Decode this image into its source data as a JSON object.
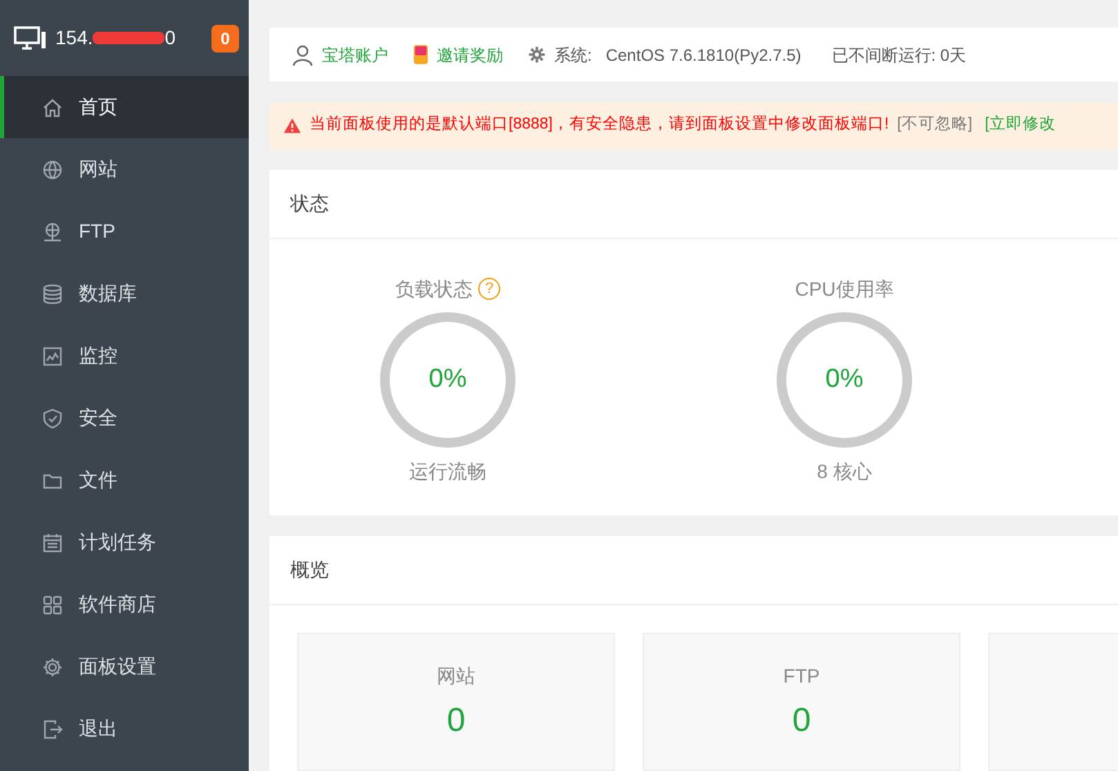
{
  "sidebar": {
    "host_start": "154.",
    "host_end": "0",
    "badge": "0",
    "items": [
      {
        "label": "首页",
        "selected": true
      },
      {
        "label": "网站",
        "selected": false
      },
      {
        "label": "FTP",
        "selected": false
      },
      {
        "label": "数据库",
        "selected": false
      },
      {
        "label": "监控",
        "selected": false
      },
      {
        "label": "安全",
        "selected": false
      },
      {
        "label": "文件",
        "selected": false
      },
      {
        "label": "计划任务",
        "selected": false
      },
      {
        "label": "软件商店",
        "selected": false
      },
      {
        "label": "面板设置",
        "selected": false
      },
      {
        "label": "退出",
        "selected": false
      }
    ]
  },
  "header": {
    "account": "宝塔账户",
    "invite": "邀请奖励",
    "system_label": "系统:",
    "system_value": "CentOS 7.6.1810(Py2.7.5)",
    "uptime": "已不间断运行: 0天"
  },
  "alert": {
    "message": "当前面板使用的是默认端口[8888]，有安全隐患，请到面板设置中修改面板端口!",
    "ignore": "[不可忽略]",
    "fix": "[立即修改"
  },
  "status": {
    "title": "状态",
    "gauges": [
      {
        "label": "负载状态",
        "help": "?",
        "value": "0%",
        "caption": "运行流畅"
      },
      {
        "label": "CPU使用率",
        "value": "0%",
        "caption": "8 核心"
      }
    ]
  },
  "overview": {
    "title": "概览",
    "cards": [
      {
        "label": "网站",
        "value": "0"
      },
      {
        "label": "FTP",
        "value": "0"
      }
    ]
  }
}
